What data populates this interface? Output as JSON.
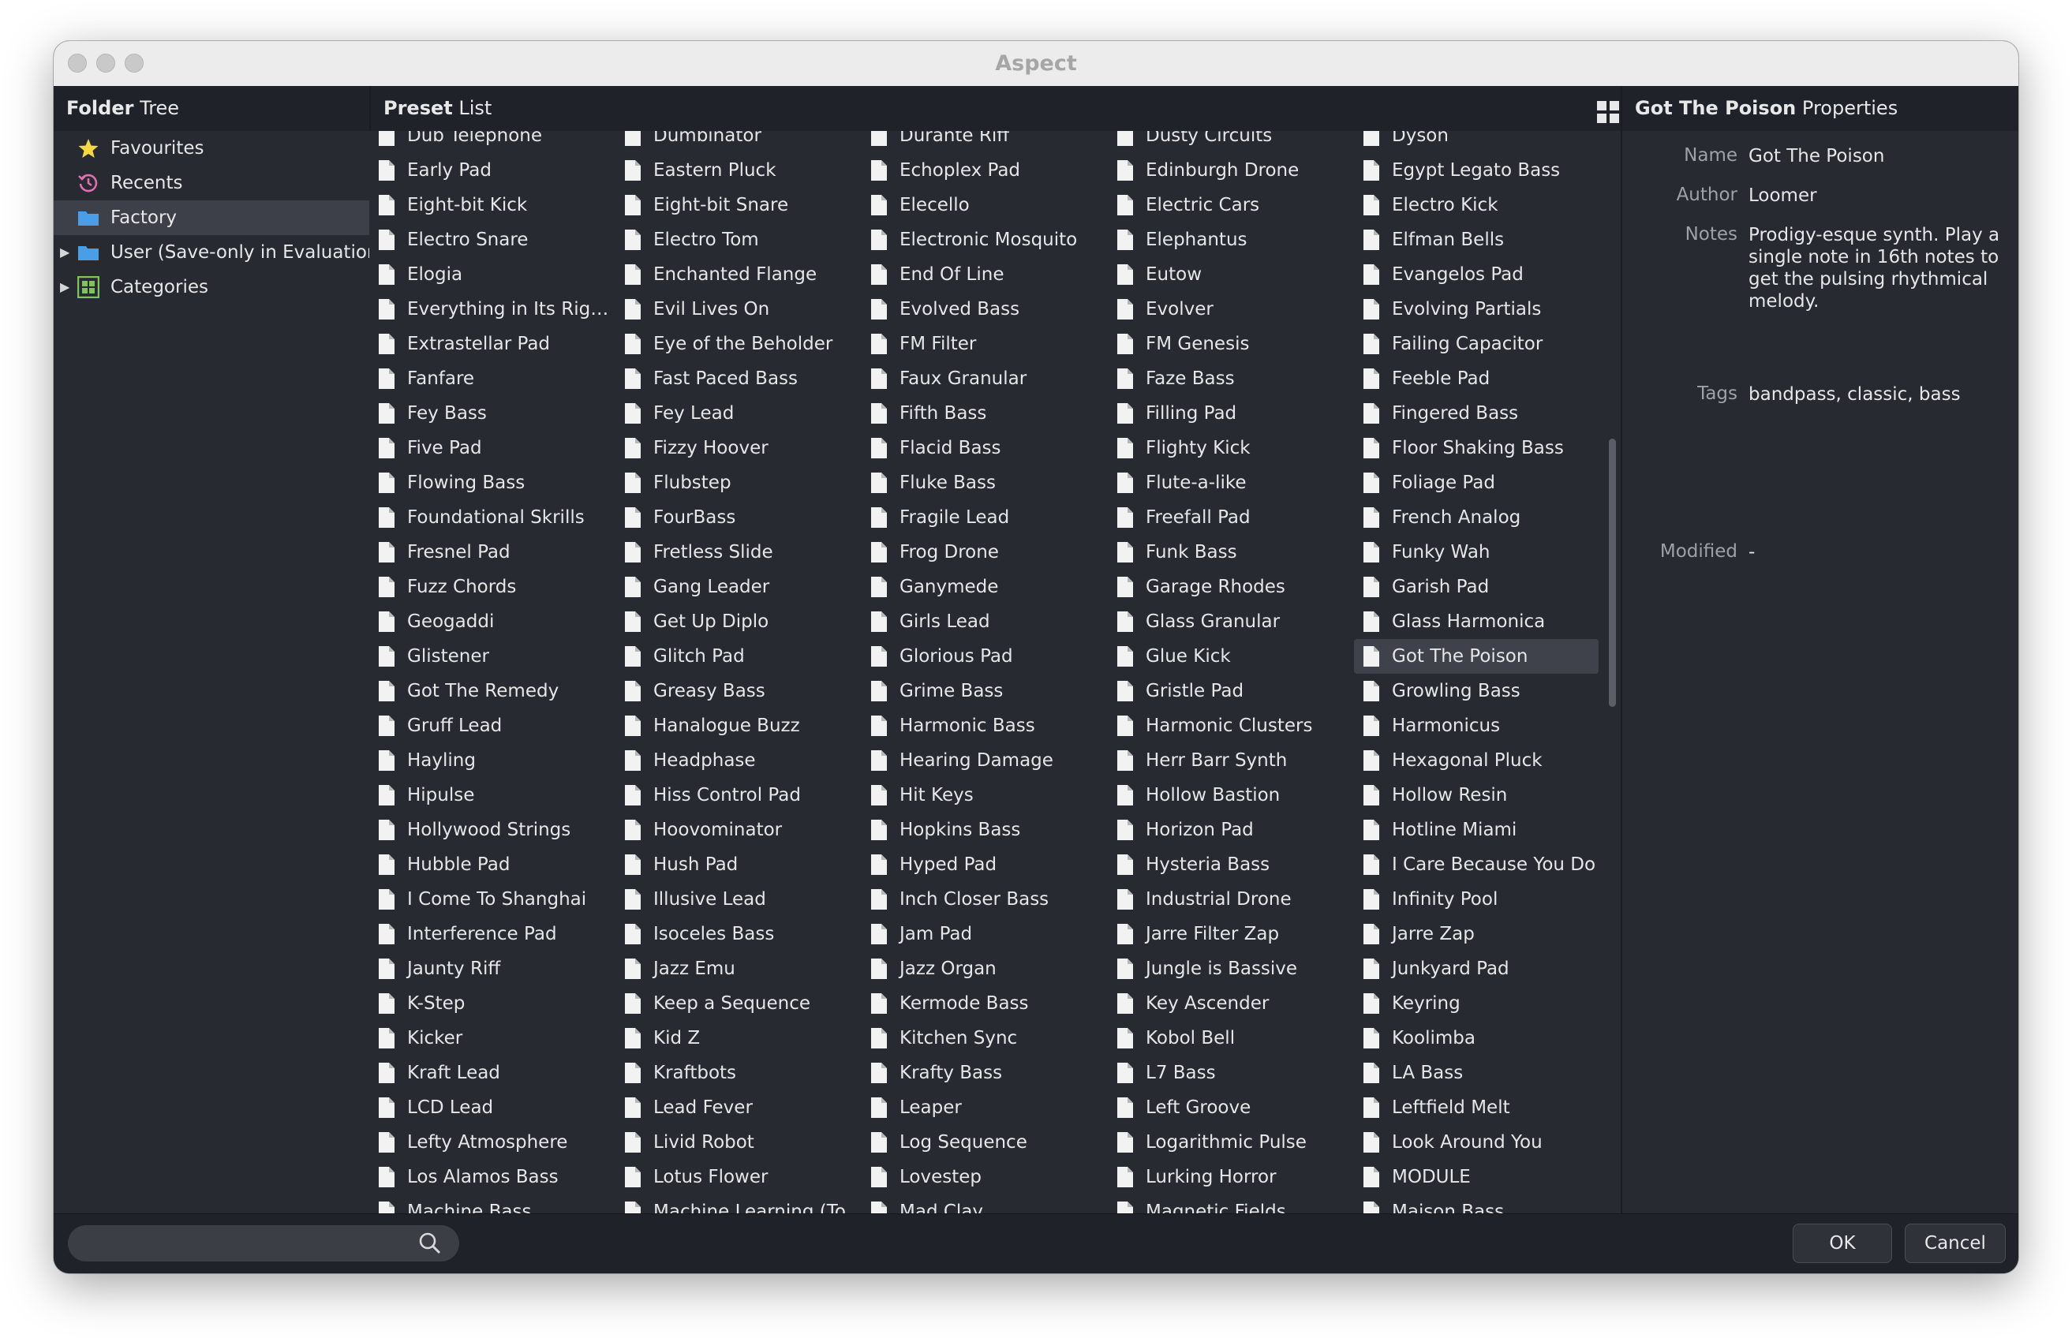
{
  "window": {
    "title": "Aspect"
  },
  "folder_tree": {
    "header_bold": "Folder",
    "header_rest": " Tree",
    "items": [
      {
        "label": "Favourites",
        "icon": "star-icon",
        "selected": false,
        "expandable": false
      },
      {
        "label": "Recents",
        "icon": "history-icon",
        "selected": false,
        "expandable": false
      },
      {
        "label": "Factory",
        "icon": "folder-icon",
        "selected": true,
        "expandable": false
      },
      {
        "label": "User (Save-only in Evaluation)",
        "icon": "folder-icon",
        "selected": false,
        "expandable": true
      },
      {
        "label": "Categories",
        "icon": "categories-icon",
        "selected": false,
        "expandable": true
      }
    ]
  },
  "preset_list": {
    "header_bold": "Preset",
    "header_rest": " List",
    "view_icons": [
      "grid-view-icon",
      "list-view-icon"
    ],
    "selected": "Got The Poison",
    "columns": [
      [
        "Dub Telephone",
        "Early Pad",
        "Eight-bit Kick",
        "Electro Snare",
        "Elogia",
        "Everything in Its Righ...",
        "Extrastellar Pad",
        "Fanfare",
        "Fey Bass",
        "Five Pad",
        "Flowing Bass",
        "Foundational Skrills",
        "Fresnel Pad",
        "Fuzz Chords",
        "Geogaddi",
        "Glistener",
        "Got The Remedy",
        "Gruff Lead",
        "Hayling",
        "Hipulse",
        "Hollywood Strings",
        "Hubble Pad",
        "I Come To Shanghai",
        "Interference Pad",
        "Jaunty Riff",
        "K-Step",
        "Kicker",
        "Kraft Lead",
        "LCD Lead",
        "Lefty Atmosphere",
        "Los Alamos Bass",
        "Machine Bass"
      ],
      [
        "Dumbinator",
        "Eastern Pluck",
        "Eight-bit Snare",
        "Electro Tom",
        "Enchanted Flange",
        "Evil Lives On",
        "Eye of the Beholder",
        "Fast Paced Bass",
        "Fey Lead",
        "Fizzy Hoover",
        "Flubstep",
        "FourBass",
        "Fretless Slide",
        "Gang Leader",
        "Get Up Diplo",
        "Glitch Pad",
        "Greasy Bass",
        "Hanalogue Buzz",
        "Headphase",
        "Hiss Control Pad",
        "Hoovominator",
        "Hush Pad",
        "Illusive Lead",
        "Isoceles Bass",
        "Jazz Emu",
        "Keep a Sequence",
        "Kid Z",
        "Kraftbots",
        "Lead Fever",
        "Livid Robot",
        "Lotus Flower",
        "Machine Learning (To"
      ],
      [
        "Durante Riff",
        "Echoplex Pad",
        "Elecello",
        "Electronic Mosquito",
        "End Of Line",
        "Evolved Bass",
        "FM Filter",
        "Faux Granular",
        "Fifth Bass",
        "Flacid Bass",
        "Fluke Bass",
        "Fragile Lead",
        "Frog Drone",
        "Ganymede",
        "Girls Lead",
        "Glorious Pad",
        "Grime Bass",
        "Harmonic Bass",
        "Hearing Damage",
        "Hit Keys",
        "Hopkins Bass",
        "Hyped Pad",
        "Inch Closer Bass",
        "Jam Pad",
        "Jazz Organ",
        "Kermode Bass",
        "Kitchen Sync",
        "Krafty Bass",
        "Leaper",
        "Log Sequence",
        "Lovestep",
        "Mad Clay"
      ],
      [
        "Dusty Circuits",
        "Edinburgh Drone",
        "Electric Cars",
        "Elephantus",
        "Eutow",
        "Evolver",
        "FM Genesis",
        "Faze Bass",
        "Filling Pad",
        "Flighty Kick",
        "Flute-a-like",
        "Freefall Pad",
        "Funk Bass",
        "Garage Rhodes",
        "Glass Granular",
        "Glue Kick",
        "Gristle Pad",
        "Harmonic Clusters",
        "Herr Barr Synth",
        "Hollow Bastion",
        "Horizon Pad",
        "Hysteria Bass",
        "Industrial Drone",
        "Jarre Filter Zap",
        "Jungle is Bassive",
        "Key Ascender",
        "Kobol Bell",
        "L7 Bass",
        "Left Groove",
        "Logarithmic Pulse",
        "Lurking Horror",
        "Magnetic Fields"
      ],
      [
        "Dyson",
        "Egypt Legato Bass",
        "Electro Kick",
        "Elfman Bells",
        "Evangelos Pad",
        "Evolving Partials",
        "Failing Capacitor",
        "Feeble Pad",
        "Fingered Bass",
        "Floor Shaking Bass",
        "Foliage Pad",
        "French Analog",
        "Funky Wah",
        "Garish Pad",
        "Glass Harmonica",
        "Got The Poison",
        "Growling Bass",
        "Harmonicus",
        "Hexagonal Pluck",
        "Hollow Resin",
        "Hotline Miami",
        "I Care Because You Do",
        "Infinity Pool",
        "Jarre Zap",
        "Junkyard Pad",
        "Keyring",
        "Koolimba",
        "LA Bass",
        "Leftfield Melt",
        "Look Around You",
        "MODULE",
        "Maison Bass"
      ]
    ]
  },
  "properties": {
    "header_bold": "Got The Poison",
    "header_rest": " Properties",
    "name_label": "Name",
    "name_value": "Got The Poison",
    "author_label": "Author",
    "author_value": "Loomer",
    "notes_label": "Notes",
    "notes_value": "Prodigy-esque synth. Play a single note in 16th notes to get the pulsing rhythmical melody.",
    "tags_label": "Tags",
    "tags_value": "bandpass, classic, bass",
    "modified_label": "Modified",
    "modified_value": "-"
  },
  "bottom_bar": {
    "search_value": "",
    "search_placeholder": "",
    "ok_label": "OK",
    "cancel_label": "Cancel"
  },
  "colors": {
    "background": "#272a31",
    "header": "#1f2228",
    "selection": "#3f424a",
    "favourites_icon": "#f5d742",
    "recents_icon": "#e06fae",
    "folder_icon": "#4a9ee8",
    "categories_icon": "#7fc35b"
  }
}
